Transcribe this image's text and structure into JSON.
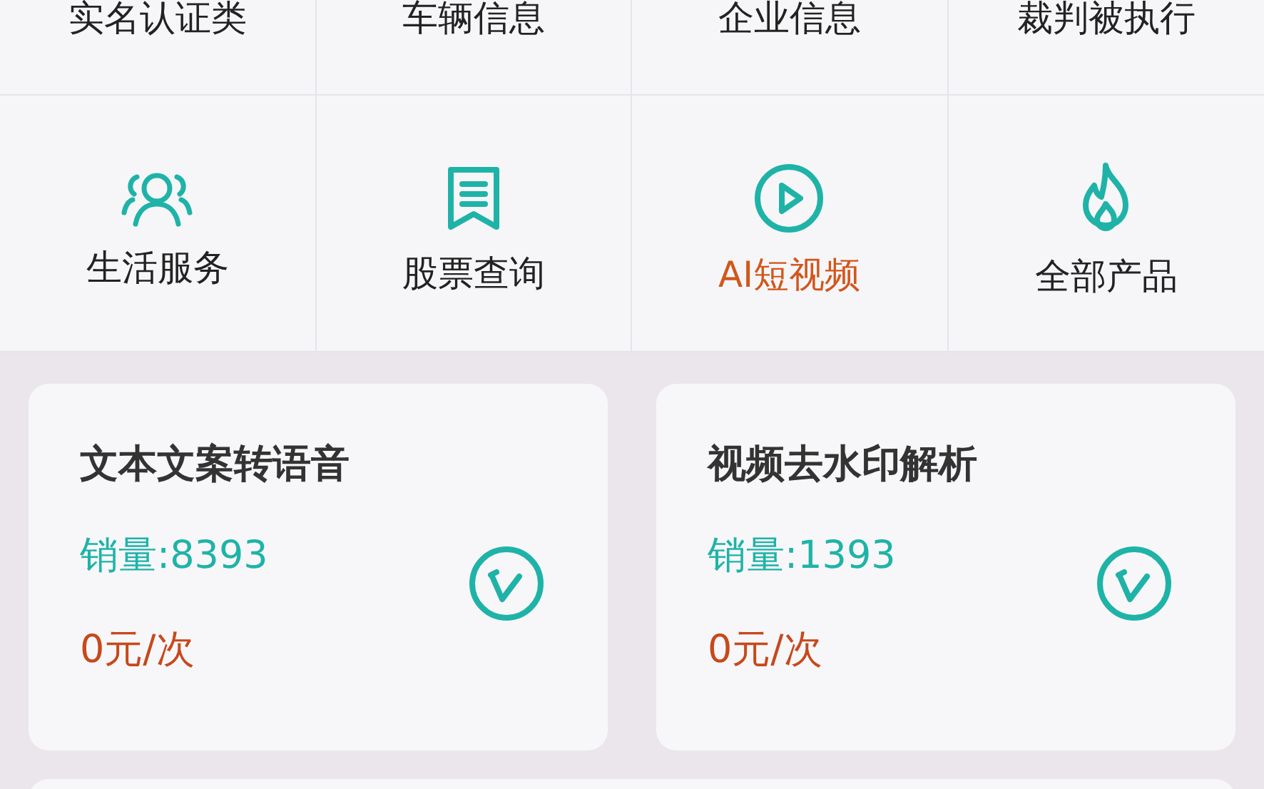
{
  "categories_top": [
    {
      "label": "实名认证类"
    },
    {
      "label": "车辆信息"
    },
    {
      "label": "企业信息"
    },
    {
      "label": "裁判被执行"
    }
  ],
  "categories": [
    {
      "label": "生活服务",
      "kind": "people",
      "highlighted": false
    },
    {
      "label": "股票查询",
      "kind": "bookmark",
      "highlighted": false
    },
    {
      "label": "AI短视频",
      "kind": "play",
      "highlighted": true
    },
    {
      "label": "全部产品",
      "kind": "flame",
      "highlighted": false
    }
  ],
  "products": [
    {
      "title": "文本文案转语音",
      "sales": "销量:8393",
      "price": "0元/次"
    },
    {
      "title": "视频去水印解析",
      "sales": "销量:1393",
      "price": "0元/次"
    }
  ]
}
